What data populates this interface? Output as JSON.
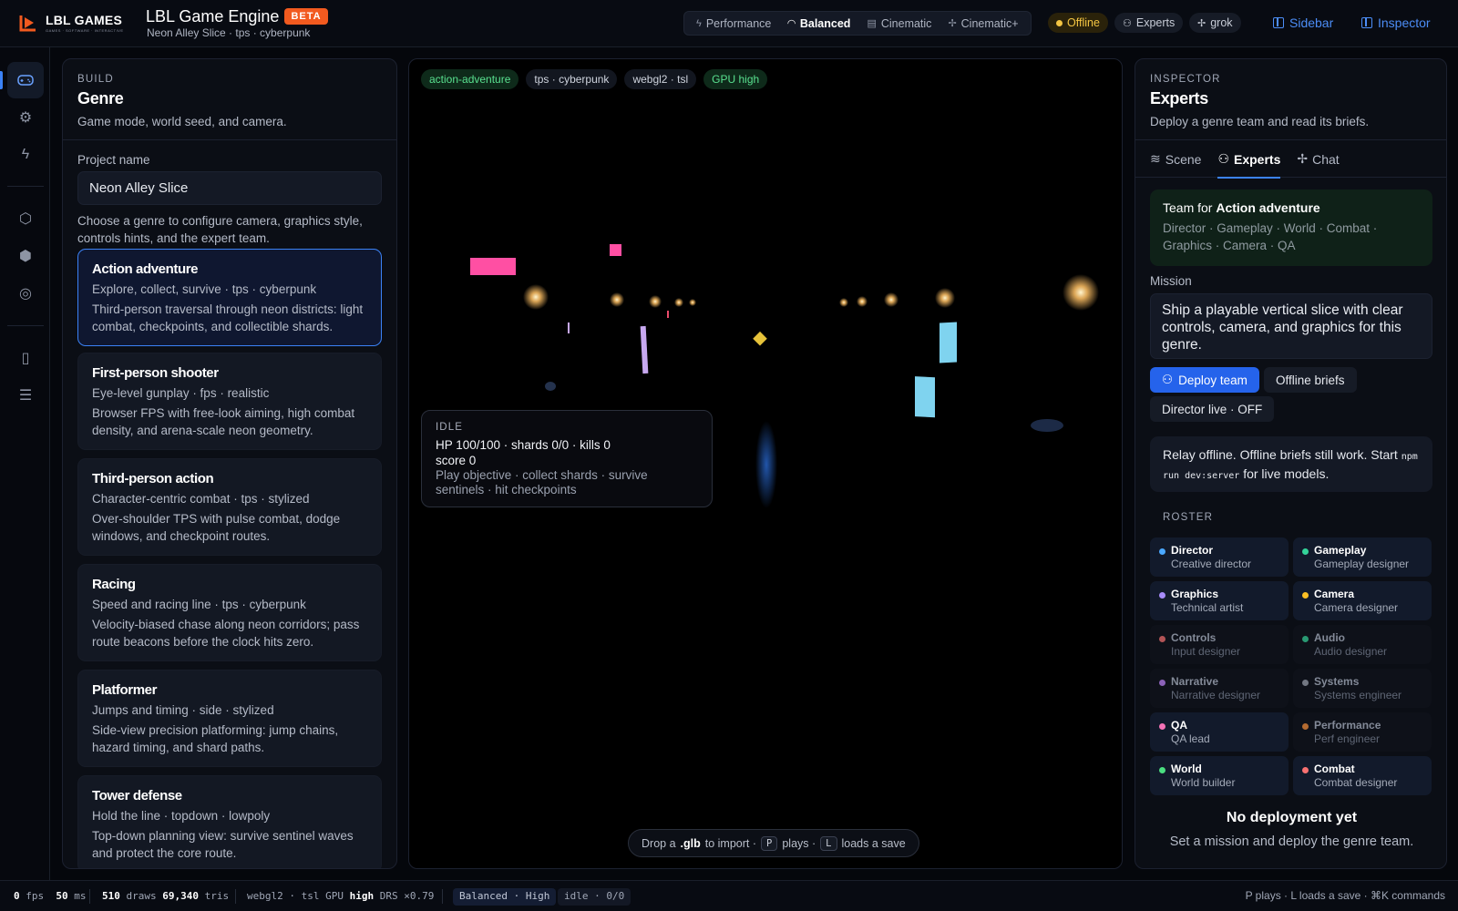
{
  "brand": {
    "logo_text": "LBL GAMES",
    "logo_sub": "GAMES · SOFTWARE · INTERACTIVE"
  },
  "app": {
    "title": "LBL Game Engine",
    "badge": "BETA",
    "subtitle": "Neon Alley Slice · tps · cyberpunk"
  },
  "quality": {
    "items": [
      {
        "label": "Performance",
        "icon": "bolt-icon",
        "active": false
      },
      {
        "label": "Balanced",
        "icon": "gauge-icon",
        "active": true
      },
      {
        "label": "Cinematic",
        "icon": "film-icon",
        "active": false
      },
      {
        "label": "Cinematic+",
        "icon": "sparkle-icon",
        "active": false
      }
    ]
  },
  "status_pills": {
    "offline": "Offline",
    "experts": "Experts",
    "grok": "grok"
  },
  "toplinks": {
    "sidebar": "Sidebar",
    "inspector": "Inspector"
  },
  "colors": {
    "accent": "#3b82f6",
    "brand": "#f25a1f",
    "offline": "#f4c542",
    "green": "#59e08f"
  },
  "left": {
    "eyebrow": "BUILD",
    "title": "Genre",
    "subtitle": "Game mode, world seed, and camera.",
    "project_label": "Project name",
    "project_value": "Neon Alley Slice",
    "hint": "Choose a genre to configure camera, graphics style, controls hints, and the expert team.",
    "genres": [
      {
        "title": "Action adventure",
        "meta": "Explore, collect, survive · tps · cyberpunk",
        "desc": "Third-person traversal through neon districts: light combat, checkpoints, and collectible shards."
      },
      {
        "title": "First-person shooter",
        "meta": "Eye-level gunplay · fps · realistic",
        "desc": "Browser FPS with free-look aiming, high combat density, and arena-scale neon geometry."
      },
      {
        "title": "Third-person action",
        "meta": "Character-centric combat · tps · stylized",
        "desc": "Over-shoulder TPS with pulse combat, dodge windows, and checkpoint routes."
      },
      {
        "title": "Racing",
        "meta": "Speed and racing line · tps · cyberpunk",
        "desc": "Velocity-biased chase along neon corridors; pass route beacons before the clock hits zero."
      },
      {
        "title": "Platformer",
        "meta": "Jumps and timing · side · stylized",
        "desc": "Side-view precision platforming: jump chains, hazard timing, and shard paths."
      },
      {
        "title": "Tower defense",
        "meta": "Hold the line · topdown · lowpoly",
        "desc": "Top-down planning view: survive sentinel waves and protect the core route."
      }
    ]
  },
  "viewport": {
    "tags": [
      "action-adventure",
      "tps · cyberpunk",
      "webgl2 · tsl",
      "GPU high"
    ],
    "hud": {
      "state": "IDLE",
      "stats": "HP 100/100 · shards 0/0 · kills 0",
      "score": "score 0",
      "objective": "Play objective · collect shards · survive sentinels · hit checkpoints"
    },
    "drop": {
      "prefix": "Drop a",
      "ext": ".glb",
      "mid": "to import ·",
      "key1": "P",
      "t1": "plays ·",
      "key2": "L",
      "t2": "loads a save"
    }
  },
  "right": {
    "eyebrow": "INSPECTOR",
    "title": "Experts",
    "subtitle": "Deploy a genre team and read its briefs.",
    "tabs": [
      "Scene",
      "Experts",
      "Chat"
    ],
    "team_prefix": "Team for",
    "team_genre": "Action adventure",
    "team_members": "Director · Gameplay · World · Combat · Graphics · Camera · QA",
    "mission_label": "Mission",
    "mission": "Ship a playable vertical slice with clear controls, camera, and graphics for this genre.",
    "deploy": "Deploy team",
    "offline_briefs": "Offline briefs",
    "director_live": "Director live · OFF",
    "relay_a": "Relay offline. Offline briefs still work. Start",
    "relay_code": "npm run dev:server",
    "relay_b": "for live models.",
    "roster_label": "ROSTER",
    "roster": [
      {
        "name": "Director",
        "desc": "Creative director",
        "color": "#4aa8ff",
        "active": true
      },
      {
        "name": "Gameplay",
        "desc": "Gameplay designer",
        "color": "#34d399",
        "active": true
      },
      {
        "name": "Graphics",
        "desc": "Technical artist",
        "color": "#a78bfa",
        "active": true
      },
      {
        "name": "Camera",
        "desc": "Camera designer",
        "color": "#fbbf24",
        "active": true
      },
      {
        "name": "Controls",
        "desc": "Input designer",
        "color": "#f87171",
        "active": false
      },
      {
        "name": "Audio",
        "desc": "Audio designer",
        "color": "#34d399",
        "active": false
      },
      {
        "name": "Narrative",
        "desc": "Narrative designer",
        "color": "#c084fc",
        "active": false
      },
      {
        "name": "Systems",
        "desc": "Systems engineer",
        "color": "#9ca3af",
        "active": false
      },
      {
        "name": "QA",
        "desc": "QA lead",
        "color": "#f472b6",
        "active": true
      },
      {
        "name": "Performance",
        "desc": "Perf engineer",
        "color": "#fb923c",
        "active": false
      },
      {
        "name": "World",
        "desc": "World builder",
        "color": "#4ade80",
        "active": true
      },
      {
        "name": "Combat",
        "desc": "Combat designer",
        "color": "#f87171",
        "active": true
      }
    ],
    "empty_title": "No deployment yet",
    "empty_sub": "Set a mission and deploy the genre team."
  },
  "statusbar": {
    "fps": "0",
    "fps_unit": "fps",
    "ms": "50",
    "ms_unit": "ms",
    "draws": "510",
    "draws_unit": "draws",
    "tris": "69,340",
    "tris_unit": "tris",
    "backend": "webgl2 · tsl GPU",
    "gpu": "high",
    "drs": "DRS ×0.79",
    "mode": "Balanced · High",
    "state": "idle · 0/0",
    "hint": "P plays · L loads a save · ⌘K commands"
  }
}
